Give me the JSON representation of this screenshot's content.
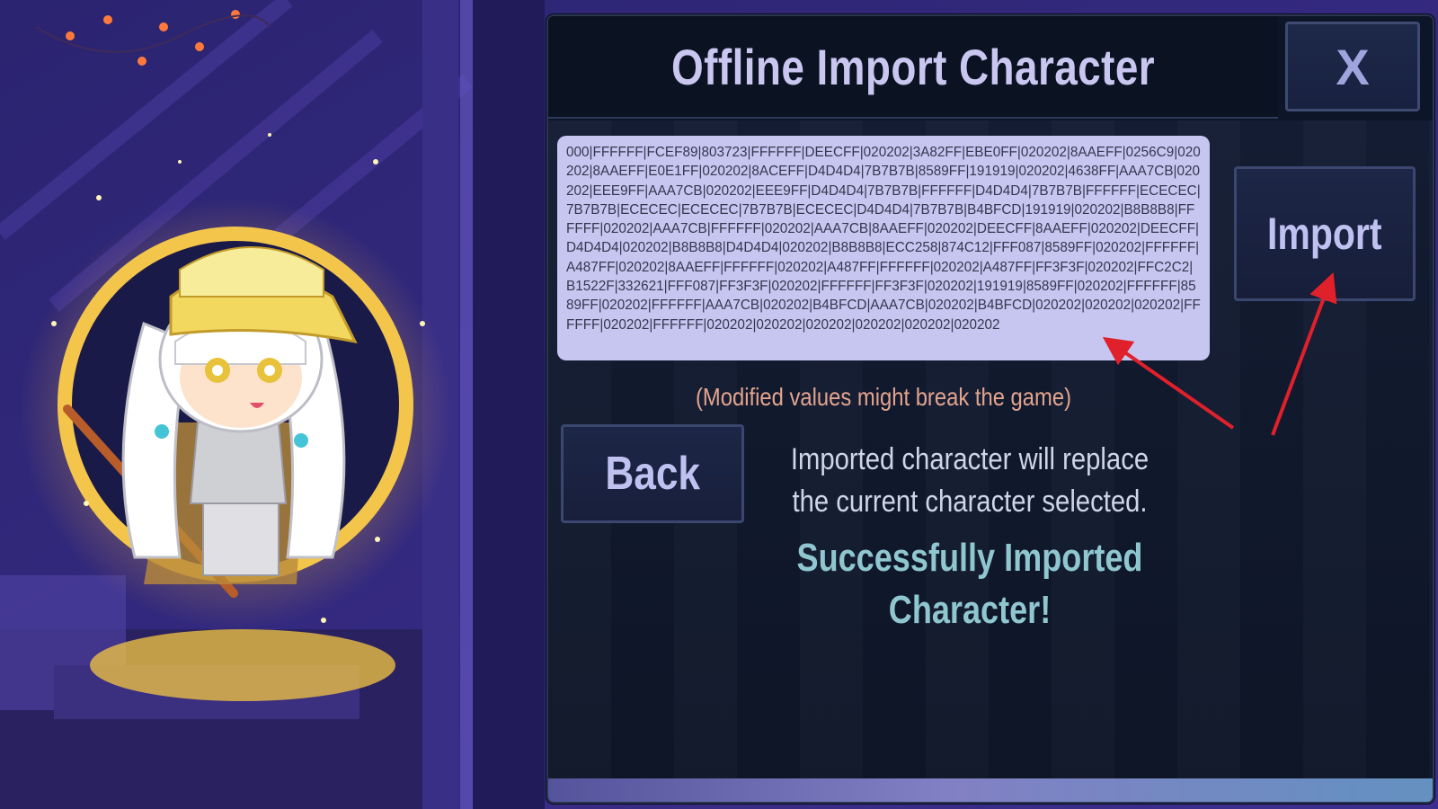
{
  "dialog": {
    "title": "Offline Import Character",
    "close_label": "X",
    "code_text": "000|FFFFFF|FCEF89|803723|FFFFFF|DEECFF|020202|3A82FF|EBE0FF|020202|8AAEFF|0256C9|020202|8AAEFF|E0E1FF|020202|8ACEFF|D4D4D4|7B7B7B|8589FF|191919|020202|4638FF|AAA7CB|020202|EEE9FF|AAA7CB|020202|EEE9FF|D4D4D4|7B7B7B|FFFFFF|D4D4D4|7B7B7B|FFFFFF|ECECEC|7B7B7B|ECECEC|ECECEC|7B7B7B|ECECEC|D4D4D4|7B7B7B|B4BFCD|191919|020202|B8B8B8|FFFFFF|020202|AAA7CB|FFFFFF|020202|AAA7CB|8AAEFF|020202|DEECFF|8AAEFF|020202|DEECFF|D4D4D4|020202|B8B8B8|D4D4D4|020202|B8B8B8|ECC258|874C12|FFF087|8589FF|020202|FFFFFF|A487FF|020202|8AAEFF|FFFFFF|020202|A487FF|FFFFFF|020202|A487FF|FF3F3F|020202|FFC2C2|B1522F|332621|FFF087|FF3F3F|020202|FFFFFF|FF3F3F|020202|191919|8589FF|020202|FFFFFF|8589FF|020202|FFFFFF|AAA7CB|020202|B4BFCD|AAA7CB|020202|B4BFCD|020202|020202|020202|FFFFFF|020202|FFFFFF|020202|020202|020202|020202|020202|020202",
    "import_label": "Import",
    "warning": "(Modified values might break the game)",
    "back_label": "Back",
    "info_line1": "Imported character will replace",
    "info_line2": "the current character selected.",
    "success_line1": "Successfully Imported",
    "success_line2": "Character!"
  },
  "colors": {
    "dialog_bg": "#0d1628",
    "title_text": "#c9c6f0",
    "code_box_bg": "#c6c6f1",
    "warning_text": "#e3a48e",
    "success_text": "#8fc6cf",
    "annotation_arrow": "#e0202a"
  },
  "icons": [
    "close-icon",
    "annotation-arrow-to-code",
    "annotation-arrow-to-import"
  ]
}
